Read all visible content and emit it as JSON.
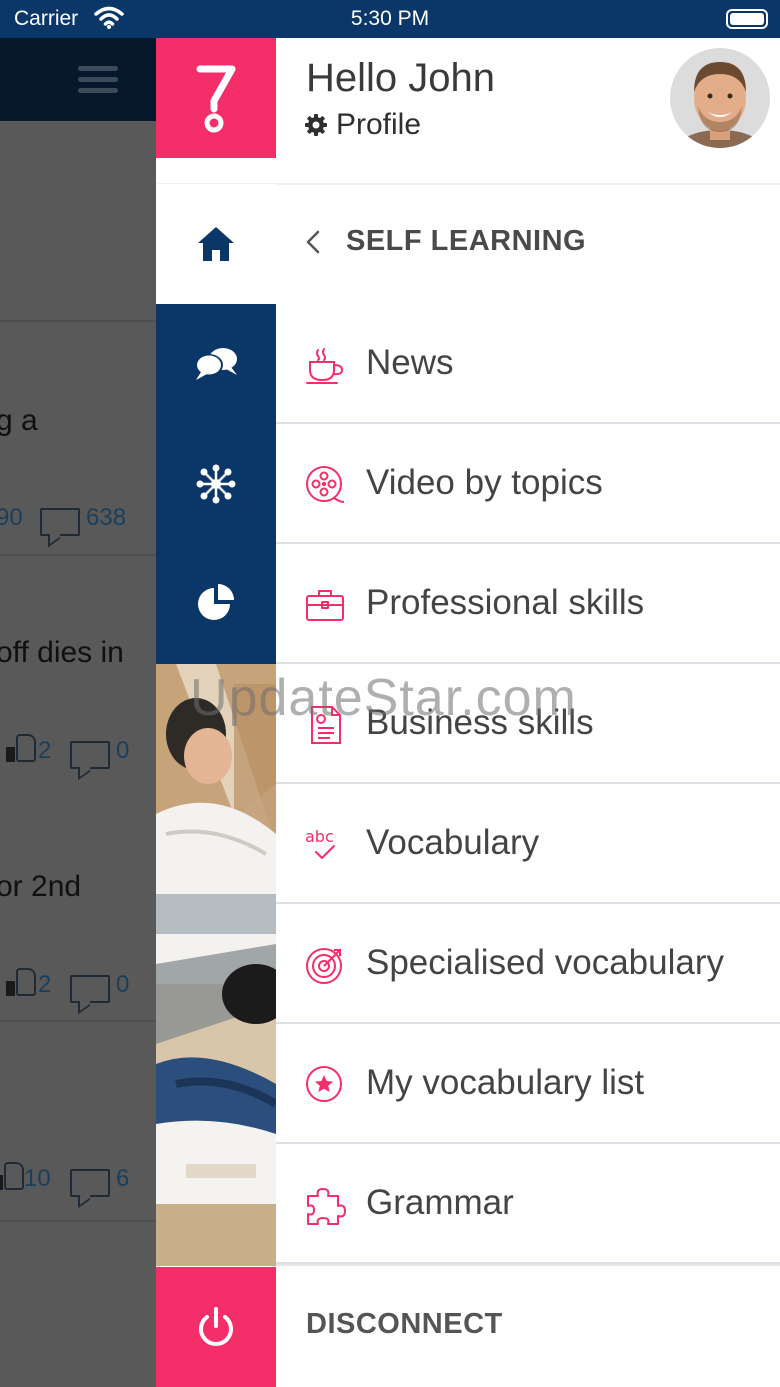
{
  "status_bar": {
    "carrier": "Carrier",
    "time": "5:30 PM"
  },
  "background_feed": {
    "items": [
      {
        "text": "g a",
        "likes": "90",
        "comments": "638"
      },
      {
        "text": "off dies in",
        "likes": "2",
        "comments": "0"
      },
      {
        "text": "or 2nd",
        "likes": "2",
        "comments": "0"
      },
      {
        "text": "",
        "likes": "10",
        "comments": "6"
      }
    ]
  },
  "drawer": {
    "greeting": "Hello John",
    "profile_label": "Profile",
    "section_title": "SELF LEARNING",
    "menu": [
      {
        "label": "News",
        "icon": "coffee-cup-icon"
      },
      {
        "label": "Video by topics",
        "icon": "film-reel-icon"
      },
      {
        "label": "Professional skills",
        "icon": "briefcase-icon"
      },
      {
        "label": "Business skills",
        "icon": "document-icon"
      },
      {
        "label": "Vocabulary",
        "icon": "abc-check-icon"
      },
      {
        "label": "Specialised vocabulary",
        "icon": "target-icon"
      },
      {
        "label": "My vocabulary list",
        "icon": "star-circle-icon"
      },
      {
        "label": "Grammar",
        "icon": "puzzle-icon"
      }
    ],
    "disconnect_label": "DISCONNECT"
  },
  "watermark": "UpdateStar.com",
  "colors": {
    "navy": "#0b3668",
    "accent_pink": "#f42e68",
    "text": "#444444"
  }
}
